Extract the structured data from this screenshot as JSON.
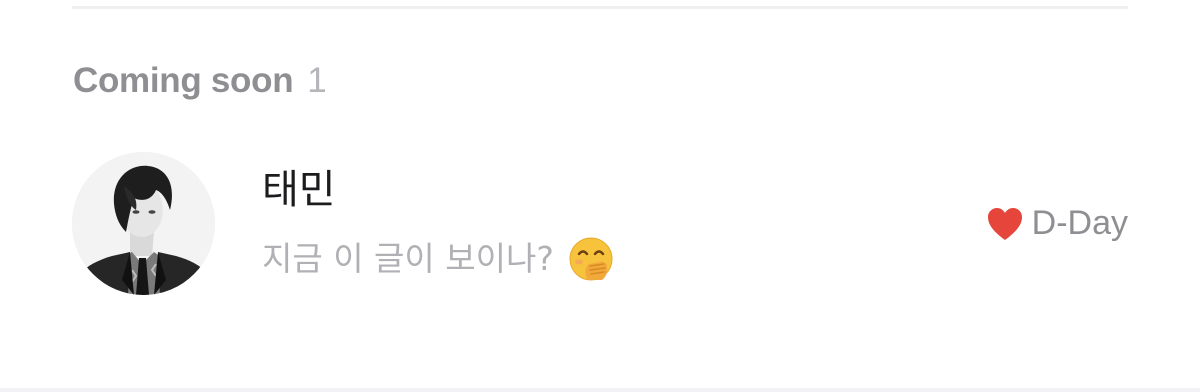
{
  "section": {
    "title": "Coming soon",
    "count": "1"
  },
  "item": {
    "name": "태민",
    "message": "지금 이 글이 보이나?",
    "message_emoji": "face-with-hand-over-mouth",
    "avatar": "profile-photo",
    "status_icon": "heart-icon",
    "status_color": "#e5453a",
    "status_text": "D-Day"
  }
}
